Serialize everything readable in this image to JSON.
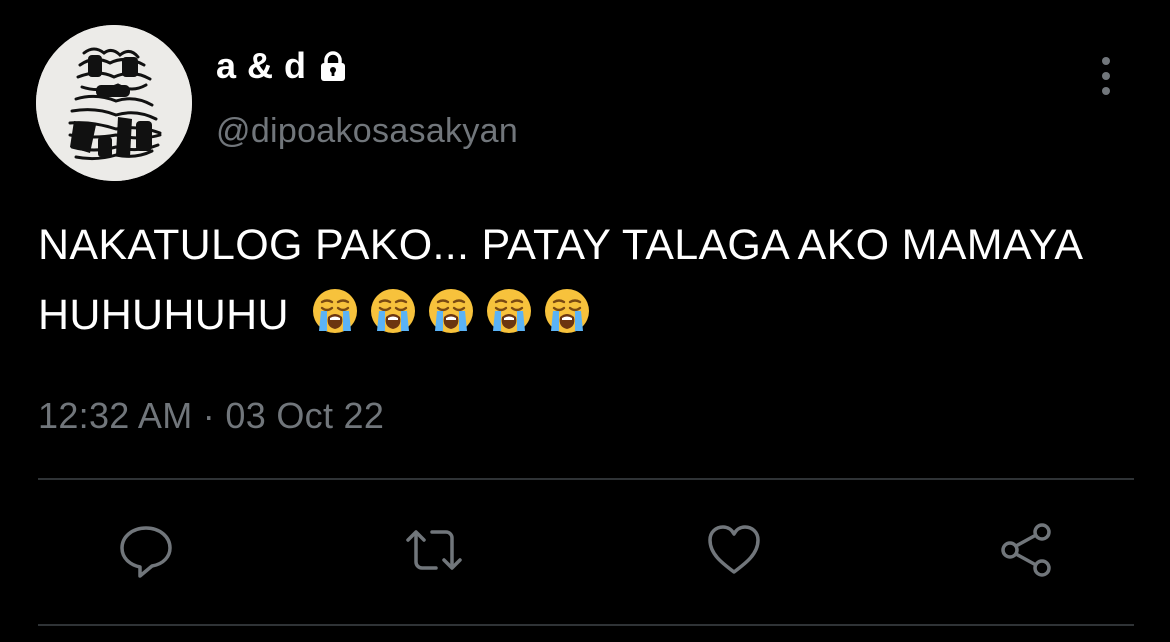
{
  "author": {
    "display_name": "a & d",
    "handle": "@dipoakosasakyan",
    "protected_icon": "lock-icon",
    "avatar": "avatar-image"
  },
  "tweet": {
    "text": "NAKATULOG PAKO... PATAY TALAGA AKO MAMAYA HUHUHUHU",
    "emojis": [
      "loudly-crying-face",
      "loudly-crying-face",
      "loudly-crying-face",
      "loudly-crying-face",
      "loudly-crying-face"
    ],
    "timestamp": "12:32 AM · 03 Oct 22"
  },
  "actions": {
    "reply_icon": "reply-icon",
    "retweet_icon": "retweet-icon",
    "like_icon": "heart-icon",
    "share_icon": "share-icon",
    "more_icon": "more-options-icon"
  },
  "colors": {
    "background": "#000000",
    "primary_text": "#ffffff",
    "secondary_text": "#71767b",
    "divider": "#2f3336"
  }
}
